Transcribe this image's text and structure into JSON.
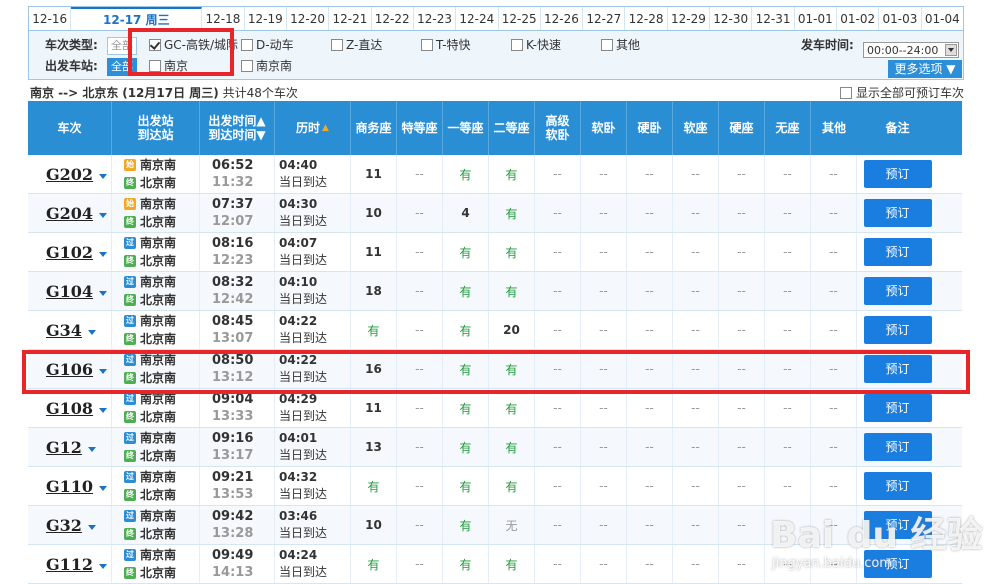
{
  "date_tabs": [
    {
      "label": "12-16",
      "active": false
    },
    {
      "label": "12-17 周三",
      "active": true
    },
    {
      "label": "12-18",
      "active": false
    },
    {
      "label": "12-19",
      "active": false
    },
    {
      "label": "12-20",
      "active": false
    },
    {
      "label": "12-21",
      "active": false
    },
    {
      "label": "12-22",
      "active": false
    },
    {
      "label": "12-23",
      "active": false
    },
    {
      "label": "12-24",
      "active": false
    },
    {
      "label": "12-25",
      "active": false
    },
    {
      "label": "12-26",
      "active": false
    },
    {
      "label": "12-27",
      "active": false
    },
    {
      "label": "12-28",
      "active": false
    },
    {
      "label": "12-29",
      "active": false
    },
    {
      "label": "12-30",
      "active": false
    },
    {
      "label": "12-31",
      "active": false
    },
    {
      "label": "01-01",
      "active": false
    },
    {
      "label": "01-02",
      "active": false
    },
    {
      "label": "01-03",
      "active": false
    },
    {
      "label": "01-04",
      "active": false
    }
  ],
  "filter": {
    "type_label": "车次类型:",
    "station_label": "出发车站:",
    "all_label": "全部",
    "types": [
      {
        "label": "GC-高铁/城际",
        "checked": true
      },
      {
        "label": "D-动车",
        "checked": false
      },
      {
        "label": "Z-直达",
        "checked": false
      },
      {
        "label": "T-特快",
        "checked": false
      },
      {
        "label": "K-快速",
        "checked": false
      },
      {
        "label": "其他",
        "checked": false
      }
    ],
    "stations": [
      {
        "label": "南京",
        "checked": false
      },
      {
        "label": "南京南",
        "checked": false
      }
    ],
    "depart_time_label": "发车时间:",
    "depart_time_value": "00:00--24:00",
    "more_options": "更多选项 ▼"
  },
  "summary": {
    "route": "南京 --> 北京东",
    "date": "(12月17日  周三)",
    "count": "共计48个车次"
  },
  "show_all_label": "显示全部可预订车次",
  "columns": {
    "train": "车次",
    "stations": [
      "出发站",
      "到达站"
    ],
    "times": [
      "出发时间▲",
      "到达时间▼"
    ],
    "duration": "历时",
    "seats": [
      "商务座",
      "特等座",
      "一等座",
      "二等座",
      "高级\n软卧",
      "软卧",
      "硬卧",
      "软座",
      "硬座",
      "无座",
      "其他"
    ],
    "remark": "备注"
  },
  "book_label": "预订",
  "station_badges": {
    "start": "始",
    "pass": "过",
    "end": "终"
  },
  "trains": [
    {
      "no": "G202",
      "from": "南京南",
      "from_type": "start",
      "to": "北京南",
      "dep": "06:52",
      "arr": "11:32",
      "dur": "04:40",
      "arrive": "当日到达",
      "seats": [
        "11",
        "--",
        "有",
        "有",
        "--",
        "--",
        "--",
        "--",
        "--",
        "--",
        "--"
      ]
    },
    {
      "no": "G204",
      "from": "南京南",
      "from_type": "start",
      "to": "北京南",
      "dep": "07:37",
      "arr": "12:07",
      "dur": "04:30",
      "arrive": "当日到达",
      "seats": [
        "10",
        "--",
        "4",
        "有",
        "--",
        "--",
        "--",
        "--",
        "--",
        "--",
        "--"
      ]
    },
    {
      "no": "G102",
      "from": "南京南",
      "from_type": "pass",
      "to": "北京南",
      "dep": "08:16",
      "arr": "12:23",
      "dur": "04:07",
      "arrive": "当日到达",
      "seats": [
        "11",
        "--",
        "有",
        "有",
        "--",
        "--",
        "--",
        "--",
        "--",
        "--",
        "--"
      ]
    },
    {
      "no": "G104",
      "from": "南京南",
      "from_type": "pass",
      "to": "北京南",
      "dep": "08:32",
      "arr": "12:42",
      "dur": "04:10",
      "arrive": "当日到达",
      "seats": [
        "18",
        "--",
        "有",
        "有",
        "--",
        "--",
        "--",
        "--",
        "--",
        "--",
        "--"
      ]
    },
    {
      "no": "G34",
      "from": "南京南",
      "from_type": "pass",
      "to": "北京南",
      "dep": "08:45",
      "arr": "13:07",
      "dur": "04:22",
      "arrive": "当日到达",
      "seats": [
        "有",
        "--",
        "有",
        "20",
        "--",
        "--",
        "--",
        "--",
        "--",
        "--",
        "--"
      ]
    },
    {
      "no": "G106",
      "from": "南京南",
      "from_type": "pass",
      "to": "北京南",
      "dep": "08:50",
      "arr": "13:12",
      "dur": "04:22",
      "arrive": "当日到达",
      "seats": [
        "16",
        "--",
        "有",
        "有",
        "--",
        "--",
        "--",
        "--",
        "--",
        "--",
        "--"
      ]
    },
    {
      "no": "G108",
      "from": "南京南",
      "from_type": "pass",
      "to": "北京南",
      "dep": "09:04",
      "arr": "13:33",
      "dur": "04:29",
      "arrive": "当日到达",
      "seats": [
        "11",
        "--",
        "有",
        "有",
        "--",
        "--",
        "--",
        "--",
        "--",
        "--",
        "--"
      ]
    },
    {
      "no": "G12",
      "from": "南京南",
      "from_type": "pass",
      "to": "北京南",
      "dep": "09:16",
      "arr": "13:17",
      "dur": "04:01",
      "arrive": "当日到达",
      "seats": [
        "13",
        "--",
        "有",
        "有",
        "--",
        "--",
        "--",
        "--",
        "--",
        "--",
        "--"
      ]
    },
    {
      "no": "G110",
      "from": "南京南",
      "from_type": "pass",
      "to": "北京南",
      "dep": "09:21",
      "arr": "13:53",
      "dur": "04:32",
      "arrive": "当日到达",
      "seats": [
        "有",
        "--",
        "有",
        "有",
        "--",
        "--",
        "--",
        "--",
        "--",
        "--",
        "--"
      ]
    },
    {
      "no": "G32",
      "from": "南京南",
      "from_type": "pass",
      "to": "北京南",
      "dep": "09:42",
      "arr": "13:28",
      "dur": "03:46",
      "arrive": "当日到达",
      "seats": [
        "10",
        "--",
        "有",
        "无",
        "--",
        "--",
        "--",
        "--",
        "--",
        "--",
        "--"
      ]
    },
    {
      "no": "G112",
      "from": "南京南",
      "from_type": "pass",
      "to": "北京南",
      "dep": "09:49",
      "arr": "14:13",
      "dur": "04:24",
      "arrive": "当日到达",
      "seats": [
        "有",
        "--",
        "有",
        "有",
        "--",
        "--",
        "--",
        "--",
        "--",
        "--",
        "--"
      ]
    }
  ],
  "watermark": {
    "logo": "Bai du 经验",
    "url": "jingyan.baidu.com"
  },
  "colors": {
    "header_blue": "#2a8ed4",
    "book_blue": "#1a7de0",
    "available_green": "#1e9a3a",
    "highlight_red": "#e8262a"
  }
}
